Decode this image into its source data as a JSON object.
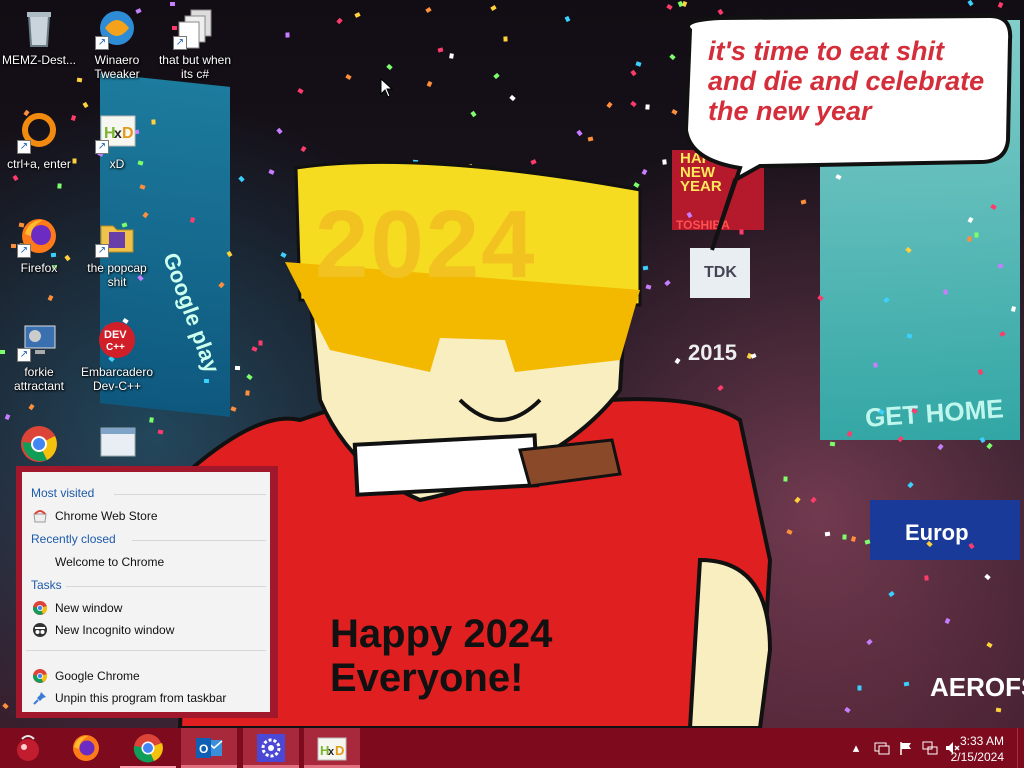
{
  "wallpaper": {
    "speech_bubble_lines": [
      "it's time to eat shit",
      "and die and celebrate",
      "the new year"
    ],
    "headband_text": "2024",
    "shirt_lines": [
      "Happy 2024",
      "Everyone!"
    ],
    "billboards": {
      "google_play": "Google play",
      "get_home": "GET HOME",
      "europ": "Europ",
      "aerofs": "AEROFS",
      "tdk": "TDK",
      "year_2015": "2015",
      "happy_new_year": "HAPPY NEW YEAR",
      "toshiba": "TOSHIBA"
    }
  },
  "desktop_icons": [
    {
      "name": "MEMZ-Dest...",
      "icon": "recycle-bin-icon"
    },
    {
      "name": "Winaero Tweaker",
      "icon": "winaero-icon"
    },
    {
      "name": "that but when its c#",
      "icon": "files-icon"
    },
    {
      "name": "ctrl+a, enter",
      "icon": "orange-ring-icon"
    },
    {
      "name": "xD",
      "icon": "hxd-icon"
    },
    {
      "name": "Firefox",
      "icon": "firefox-icon"
    },
    {
      "name": "the popcap shit",
      "icon": "folder-icon"
    },
    {
      "name": "forkie attractant",
      "icon": "settings-monitor-icon"
    },
    {
      "name": "Embarcadero Dev-C++",
      "icon": "devcpp-icon"
    }
  ],
  "jump_list": {
    "sections": {
      "most_visited": "Most visited",
      "recently_closed": "Recently closed",
      "tasks": "Tasks"
    },
    "items": {
      "chrome_web_store": "Chrome Web Store",
      "welcome": "Welcome to Chrome",
      "new_window": "New window",
      "new_incognito": "New Incognito window",
      "google_chrome": "Google Chrome",
      "unpin": "Unpin this program from taskbar"
    }
  },
  "taskbar": {
    "apps": [
      "start-button-icon",
      "firefox-icon",
      "chrome-icon",
      "outlook-icon",
      "settings-icon",
      "hxd-icon"
    ],
    "active_app": "chrome",
    "tray_icons": [
      "chevron-up-icon",
      "display-icon",
      "flag-icon",
      "network-icon",
      "volume-muted-icon"
    ],
    "clock": {
      "time": "3:33 AM",
      "date": "2/15/2024"
    }
  },
  "colors": {
    "taskbar_bg": "#7d0a1d",
    "jumplist_border": "#a1182c",
    "jumplist_header": "#1d5aa8",
    "bubble_text": "#d42e3b",
    "headband": "#f2c320",
    "shirt": "#e02020"
  }
}
